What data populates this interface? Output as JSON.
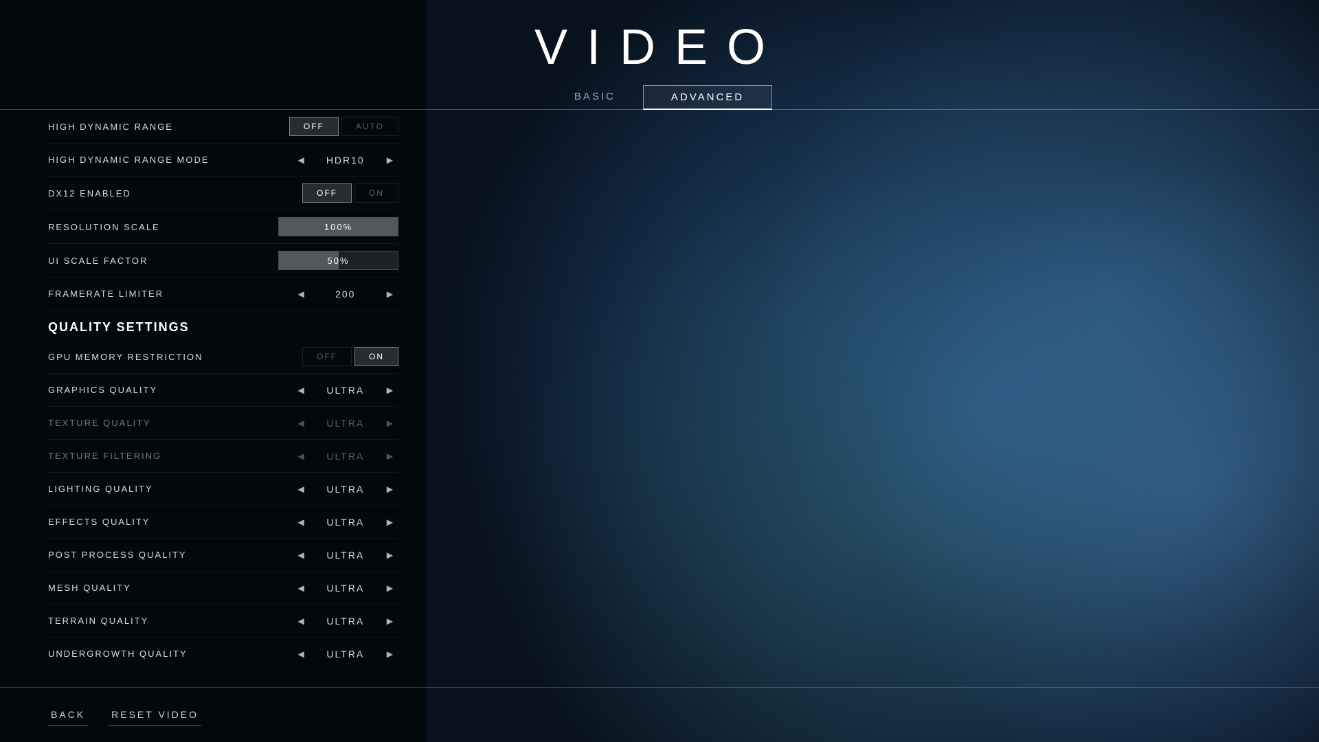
{
  "page": {
    "title": "VIDEO",
    "bg_color": "#08121e"
  },
  "tabs": [
    {
      "id": "basic",
      "label": "BASIC",
      "active": false
    },
    {
      "id": "advanced",
      "label": "ADVANCED",
      "active": true
    }
  ],
  "settings": {
    "sections": [
      {
        "type": "setting",
        "label": "HIGH DYNAMIC RANGE",
        "control": "toggle",
        "value": "OFF",
        "options": [
          "OFF",
          "AUTO"
        ]
      },
      {
        "type": "setting",
        "label": "HIGH DYNAMIC RANGE MODE",
        "control": "arrow",
        "value": "HDR10"
      },
      {
        "type": "setting",
        "label": "DX12 ENABLED",
        "control": "toggle",
        "value": "OFF",
        "options": [
          "OFF",
          "ON"
        ]
      },
      {
        "type": "setting",
        "label": "RESOLUTION SCALE",
        "control": "slider",
        "value": "100%",
        "fill": 100
      },
      {
        "type": "setting",
        "label": "UI SCALE FACTOR",
        "control": "slider",
        "value": "50%",
        "fill": 50
      },
      {
        "type": "setting",
        "label": "FRAMERATE LIMITER",
        "control": "arrow",
        "value": "200"
      },
      {
        "type": "section_header",
        "label": "QUALITY SETTINGS"
      },
      {
        "type": "setting",
        "label": "GPU MEMORY RESTRICTION",
        "control": "toggle",
        "value": "ON",
        "options": [
          "OFF",
          "ON"
        ]
      },
      {
        "type": "setting",
        "label": "GRAPHICS QUALITY",
        "control": "arrow",
        "value": "ULTRA",
        "dimmed": false
      },
      {
        "type": "setting",
        "label": "TEXTURE QUALITY",
        "control": "arrow",
        "value": "ULTRA",
        "dimmed": true
      },
      {
        "type": "setting",
        "label": "TEXTURE FILTERING",
        "control": "arrow",
        "value": "ULTRA",
        "dimmed": true
      },
      {
        "type": "setting",
        "label": "LIGHTING QUALITY",
        "control": "arrow",
        "value": "ULTRA",
        "dimmed": false
      },
      {
        "type": "setting",
        "label": "EFFECTS QUALITY",
        "control": "arrow",
        "value": "ULTRA",
        "dimmed": false
      },
      {
        "type": "setting",
        "label": "POST PROCESS QUALITY",
        "control": "arrow",
        "value": "ULTRA",
        "dimmed": false
      },
      {
        "type": "setting",
        "label": "MESH QUALITY",
        "control": "arrow",
        "value": "ULTRA",
        "dimmed": false
      },
      {
        "type": "setting",
        "label": "TERRAIN QUALITY",
        "control": "arrow",
        "value": "ULTRA",
        "dimmed": false
      },
      {
        "type": "setting",
        "label": "UNDERGROWTH QUALITY",
        "control": "arrow",
        "value": "ULTRA",
        "dimmed": false
      }
    ]
  },
  "bottom_buttons": [
    {
      "id": "back",
      "label": "BACK"
    },
    {
      "id": "reset-video",
      "label": "RESET VIDEO"
    }
  ]
}
